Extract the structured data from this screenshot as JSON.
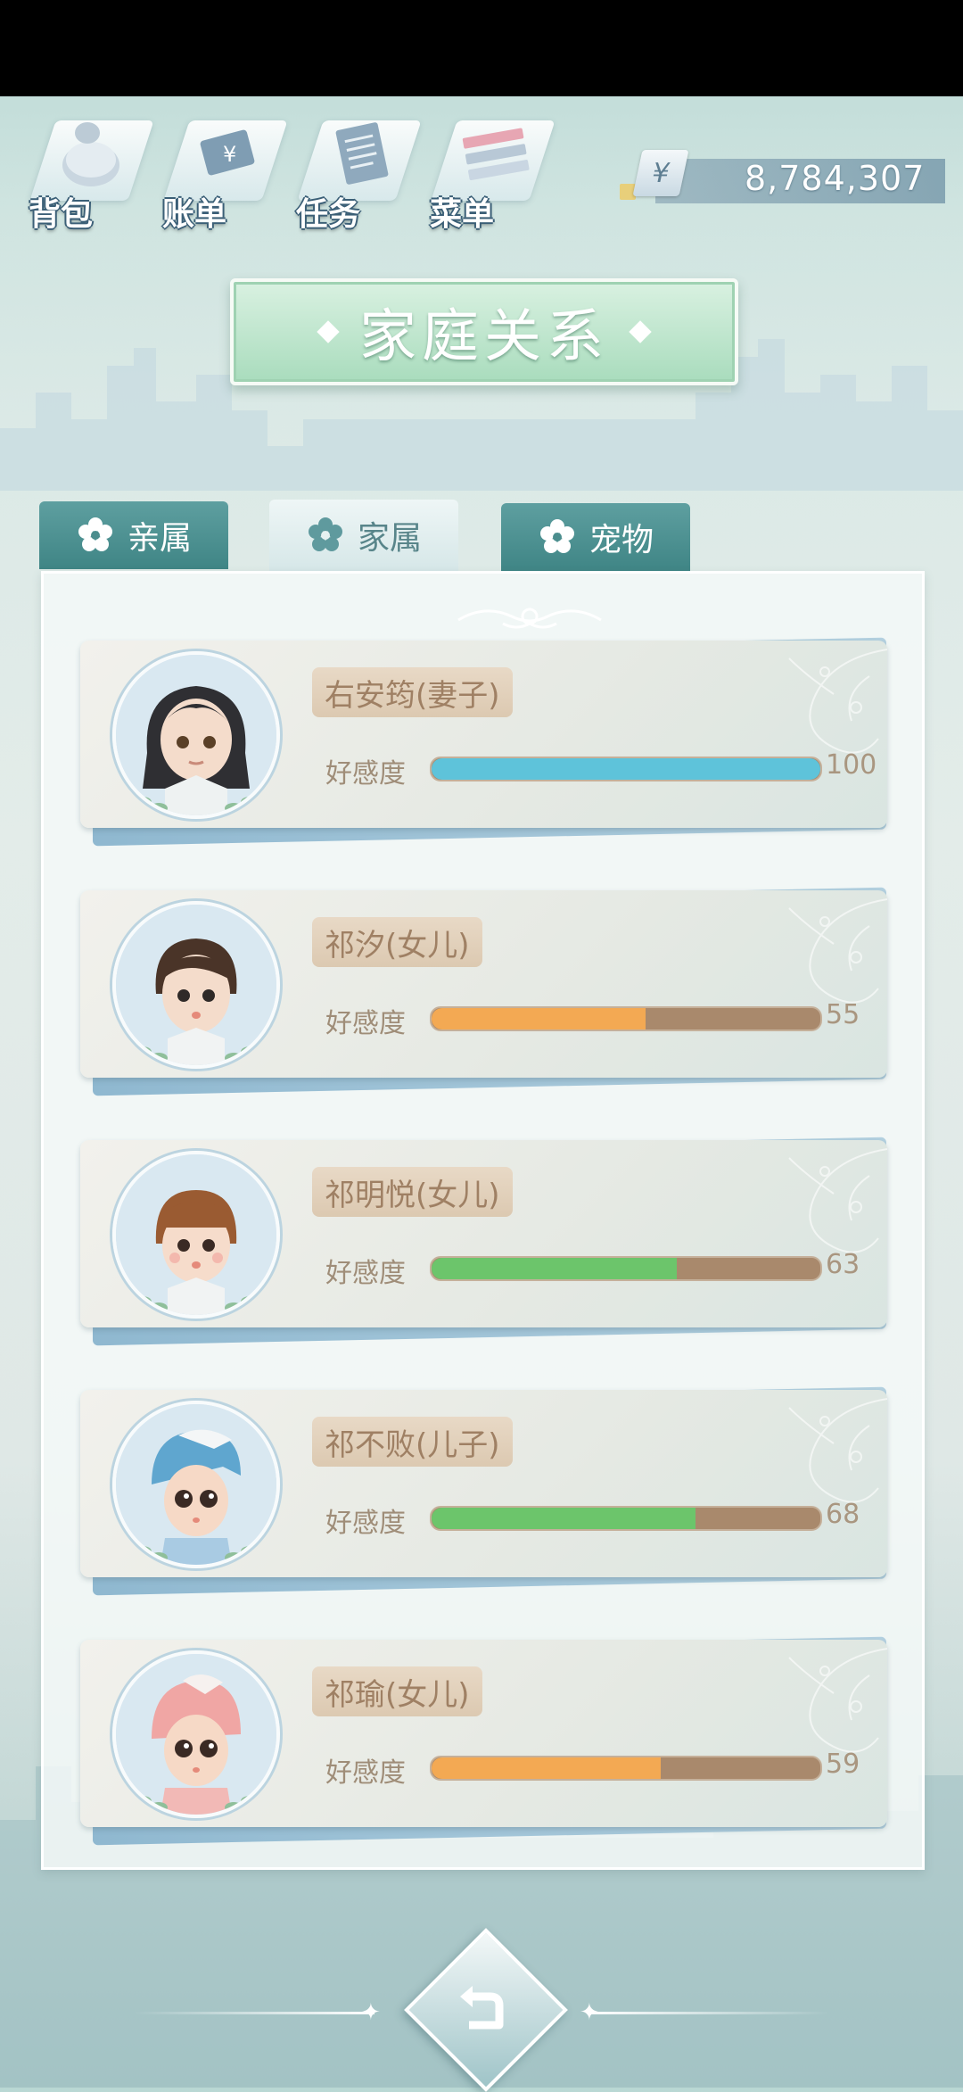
{
  "topnav": {
    "items": [
      {
        "label": "背包",
        "icon": "backpack-icon"
      },
      {
        "label": "账单",
        "icon": "bill-icon"
      },
      {
        "label": "任务",
        "icon": "task-icon"
      },
      {
        "label": "菜单",
        "icon": "menu-icon"
      }
    ]
  },
  "money": {
    "symbol": "¥",
    "value": "8,784,307"
  },
  "title": "家庭关系",
  "tabs": [
    {
      "label": "亲属",
      "active": false
    },
    {
      "label": "家属",
      "active": true
    },
    {
      "label": "宠物",
      "active": false
    }
  ],
  "affinity_label": "好感度",
  "members": [
    {
      "name": "右安筠(妻子)",
      "value": "100",
      "level": 1.0,
      "color": "#5ec3da",
      "avatar": "woman-avatar"
    },
    {
      "name": "祁汐(女儿)",
      "value": "55",
      "level": 0.55,
      "color": "#f3a953",
      "avatar": "girl-avatar"
    },
    {
      "name": "祁明悦(女儿)",
      "value": "63",
      "level": 0.63,
      "color": "#6cc56b",
      "avatar": "child-avatar"
    },
    {
      "name": "祁不败(儿子)",
      "value": "68",
      "level": 0.68,
      "color": "#6cc56b",
      "avatar": "baby-penguin-avatar"
    },
    {
      "name": "祁瑜(女儿)",
      "value": "59",
      "level": 0.59,
      "color": "#f3a953",
      "avatar": "baby-flamingo-avatar"
    }
  ]
}
